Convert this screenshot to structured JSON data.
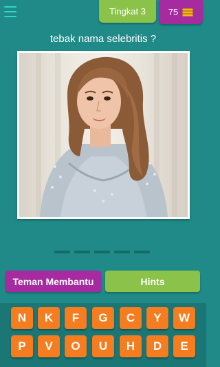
{
  "header": {
    "level_label": "Tingkat 3",
    "coins": "75"
  },
  "question": "tebak nama selebritis ?",
  "answer": {
    "slot_count": 5
  },
  "buttons": {
    "help_label": "Teman Membantu",
    "hints_label": "Hints"
  },
  "letters": {
    "row1": [
      "N",
      "K",
      "F",
      "G",
      "C",
      "Y",
      "W"
    ],
    "row2": [
      "P",
      "V",
      "O",
      "U",
      "H",
      "D",
      "E"
    ]
  },
  "colors": {
    "background": "#1f8a87",
    "keyboard_background": "#1a7775",
    "key": "#f57c1f",
    "purple": "#a62aa0",
    "green": "#8bc34a",
    "menu_icon": "#2fd6c6"
  }
}
